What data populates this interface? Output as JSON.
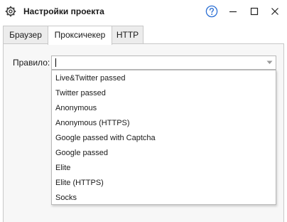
{
  "window": {
    "title": "Настройки проекта",
    "icons": {
      "app": "gear-icon",
      "help": "help-icon",
      "minimize": "minimize-icon",
      "maximize": "maximize-icon",
      "close": "close-icon"
    }
  },
  "tabs": [
    {
      "label": "Браузер",
      "active": false
    },
    {
      "label": "Проксичекер",
      "active": true
    },
    {
      "label": "HTTP",
      "active": false
    }
  ],
  "rule": {
    "label": "Правило:",
    "value": "",
    "options": [
      "Live&Twitter passed",
      "Twitter passed",
      "Anonymous",
      "Anonymous (HTTPS)",
      "Google passed with Captcha",
      "Google passed",
      "Elite",
      "Elite (HTTPS)",
      "Socks"
    ]
  },
  "colors": {
    "accent": "#2b6fd4",
    "tab_inactive": "#ececec",
    "panel": "#f7f7f7",
    "border": "#c8c8c8"
  }
}
